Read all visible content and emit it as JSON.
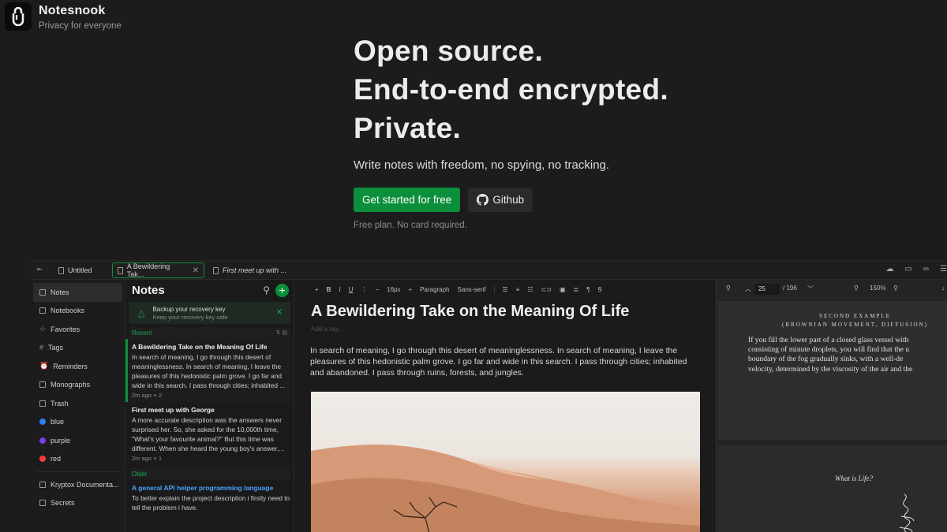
{
  "brand": {
    "name": "Notesnook",
    "tagline": "Privacy for everyone"
  },
  "hero": {
    "line1": "Open source.",
    "line2": "End-to-end encrypted.",
    "line3": "Private.",
    "subtitle": "Write notes with freedom, no spying, no tracking.",
    "cta_primary": "Get started for free",
    "cta_github": "Github",
    "note": "Free plan. No card required."
  },
  "colors": {
    "accent": "#0b8f3a",
    "link": "#4aa3ff",
    "background": "#1c1c1c"
  },
  "app": {
    "tabs": [
      {
        "label": "Untitled"
      },
      {
        "label": "A Bewildering Tak..."
      },
      {
        "label": "First meet up with ..."
      }
    ],
    "sidebar": {
      "items": [
        {
          "label": "Notes",
          "icon": "note-icon"
        },
        {
          "label": "Notebooks",
          "icon": "notebook-icon"
        },
        {
          "label": "Favorites",
          "icon": "star-icon"
        },
        {
          "label": "Tags",
          "icon": "hash-icon"
        },
        {
          "label": "Reminders",
          "icon": "alarm-icon"
        },
        {
          "label": "Monographs",
          "icon": "monograph-icon"
        },
        {
          "label": "Trash",
          "icon": "trash-icon"
        }
      ],
      "colors": [
        {
          "label": "blue",
          "color": "#2f7cf6"
        },
        {
          "label": "purple",
          "color": "#7b3fe4"
        },
        {
          "label": "red",
          "color": "#f23b3b"
        }
      ],
      "shortcuts": [
        {
          "label": "Kryptox Documenta...",
          "icon": "notebook-icon"
        },
        {
          "label": "Secrets",
          "icon": "notebook-icon"
        }
      ]
    },
    "notes": {
      "title": "Notes",
      "backup": {
        "title": "Backup your recovery key",
        "subtitle": "Keep your recovery key safe"
      },
      "groups": {
        "recent": "Recent",
        "older": "Older"
      },
      "items": [
        {
          "title": "A Bewildering Take on the Meaning Of Life",
          "body": "In search of meaning, I go through this desert of meaninglessness. In search of meaning, I leave the pleasures of this hedonistic palm grove. I go far and wide in this search. I pass through cities; inhabited ...",
          "meta": "2m ago ⋄ 2"
        },
        {
          "title": "First meet up with George",
          "body": "A more accurate description was the answers never surprised her. So, she asked for the 10,000th time, \"What's your favourite animal?\" But this time was different. When she heard the young boy's answer,...",
          "meta": "2m ago ⋄ 1"
        },
        {
          "title": "A general API helper programming language",
          "body": "To better explain the project description i firstly need to tell the problem i have."
        }
      ]
    },
    "editor": {
      "toolbar": {
        "font_size": "16px",
        "paragraph": "Paragraph",
        "font_family": "Sans-serif"
      },
      "title": "A Bewildering Take on the Meaning Of Life",
      "tag_placeholder": "Add a tag...",
      "body": "In search of meaning, I go through this desert of meaninglessness. In search of meaning, I leave the pleasures of this hedonistic palm grove. I go far and wide in this search. I pass through cities; inhabited and abandoned. I pass through ruins, forests, and jungles."
    },
    "pdf": {
      "page": "25",
      "total": "/ 196",
      "zoom": "150%",
      "heading1": "SECOND EXAMPLE",
      "heading2": "(BROWNIAN MOVEMENT, DIFFUSION)",
      "lines": [
        "If you fill the lower part of a closed glass vessel with",
        "consisting of minute droplets, you will find that the u",
        "boundary of the fog gradually sinks, with a well-de",
        "velocity, determined by the viscosity of the air and the"
      ],
      "page2_title": "What is Life?"
    }
  }
}
